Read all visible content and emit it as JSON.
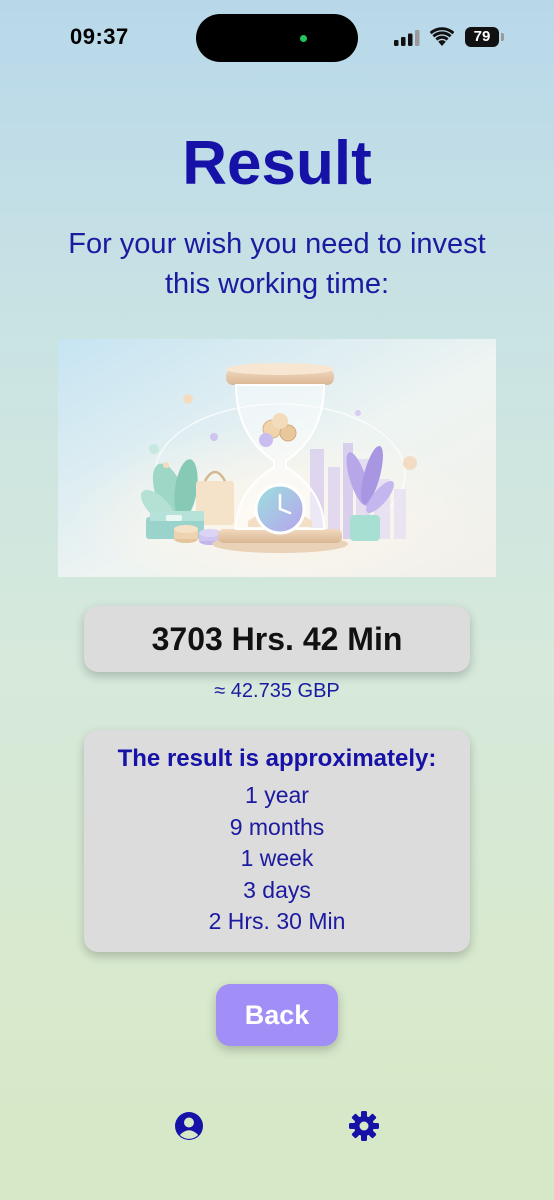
{
  "status_bar": {
    "time": "09:37",
    "battery_level": "79"
  },
  "page": {
    "title": "Result",
    "subtitle": "For your wish you need to invest this working time:"
  },
  "illustration": {
    "icon": "hourglass-coins-clock-illustration"
  },
  "result": {
    "working_time": "3703 Hrs. 42 Min",
    "currency_value": "≈ 42.735 GBP"
  },
  "approximation": {
    "heading": "The result is approximately:",
    "items": [
      "1 year",
      "9 months",
      "1 week",
      "3 days",
      "2 Hrs. 30 Min"
    ]
  },
  "actions": {
    "back_label": "Back"
  },
  "nav": {
    "profile_icon": "user-circle-icon",
    "settings_icon": "gear-icon"
  },
  "colors": {
    "accent": "#1612a8",
    "button": "#a18ef6",
    "card": "#dcdcdc"
  }
}
